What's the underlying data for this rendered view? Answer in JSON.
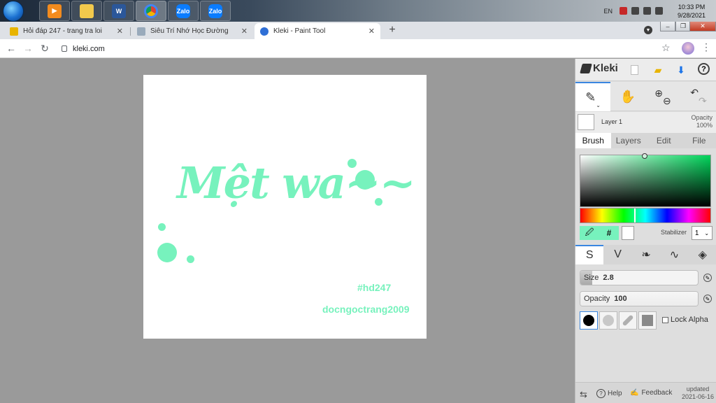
{
  "taskbar": {
    "tray_lang": "EN",
    "clock_time": "10:33 PM",
    "clock_date": "9/28/2021",
    "apps": [
      "media-player",
      "file-explorer",
      "word",
      "chrome",
      "zalo",
      "zalo-alt"
    ]
  },
  "browser": {
    "tabs": [
      {
        "title": "Hỏi đáp 247 - trang tra loi",
        "favicon_color": "#e8b400"
      },
      {
        "title": "Siêu Trí Nhớ Học Đường",
        "favicon_color": "#9ab"
      },
      {
        "title": "Kleki - Paint Tool",
        "favicon_color": "#2f6fd6"
      }
    ],
    "new_tab": "+",
    "url": "kleki.com"
  },
  "artwork": {
    "title_text": "Mệt wa~~",
    "hashtag": "#hd247",
    "signature": "docngoctrang2009",
    "accent_color": "#77f2bd"
  },
  "panel": {
    "app_name": "Kleki",
    "layer_name": "Layer 1",
    "opacity_label": "Opacity",
    "opacity_value": "100%",
    "tabs": [
      "Brush",
      "Layers",
      "Edit",
      "File"
    ],
    "active_tab": "Brush",
    "hex_button": "#",
    "stabilizer_label": "Stabilizer",
    "stabilizer_value": "1",
    "size_label": "Size",
    "size_value": "2.8",
    "brush_opacity_label": "Opacity",
    "brush_opacity_value": "100",
    "lock_alpha": "Lock Alpha",
    "help": "Help",
    "feedback": "Feedback",
    "updated_label": "updated",
    "updated_date": "2021-06-16"
  },
  "sliders": {
    "size_fraction": 0.1,
    "opacity_fraction": 1.0
  }
}
